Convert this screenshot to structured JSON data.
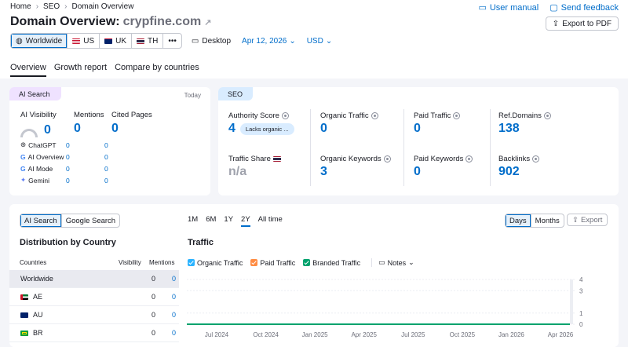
{
  "breadcrumb": [
    "Home",
    "SEO",
    "Domain Overview"
  ],
  "header": {
    "title_prefix": "Domain Overview:",
    "domain": "crypfine.com",
    "user_manual": "User manual",
    "send_feedback": "Send feedback",
    "export_pdf": "Export to PDF"
  },
  "filters": {
    "regions": [
      "Worldwide",
      "US",
      "UK",
      "TH"
    ],
    "more": "•••",
    "device": "Desktop",
    "date": "Apr 12, 2026",
    "currency": "USD"
  },
  "tabs": [
    "Overview",
    "Growth report",
    "Compare by countries"
  ],
  "ai_search": {
    "badge": "AI Search",
    "date_label": "Today",
    "visibility_label": "AI Visibility",
    "visibility_value": "0",
    "mentions_label": "Mentions",
    "mentions_value": "0",
    "cited_label": "Cited Pages",
    "cited_value": "0",
    "rows": [
      {
        "name": "ChatGPT",
        "mentions": "0",
        "cited": "0"
      },
      {
        "name": "AI Overview",
        "mentions": "0",
        "cited": "0"
      },
      {
        "name": "AI Mode",
        "mentions": "0",
        "cited": "0"
      },
      {
        "name": "Gemini",
        "mentions": "0",
        "cited": "0"
      }
    ]
  },
  "seo": {
    "badge": "SEO",
    "authority_label": "Authority Score",
    "authority_value": "4",
    "authority_note": "Lacks organic ...",
    "organic_traffic_label": "Organic Traffic",
    "organic_traffic_value": "0",
    "paid_traffic_label": "Paid Traffic",
    "paid_traffic_value": "0",
    "ref_domains_label": "Ref.Domains",
    "ref_domains_value": "138",
    "traffic_share_label": "Traffic Share",
    "traffic_share_value": "n/a",
    "organic_keywords_label": "Organic Keywords",
    "organic_keywords_value": "3",
    "paid_keywords_label": "Paid Keywords",
    "paid_keywords_value": "0",
    "backlinks_label": "Backlinks",
    "backlinks_value": "902"
  },
  "distribution": {
    "toggle": [
      "AI Search",
      "Google Search"
    ],
    "title": "Distribution by Country",
    "columns": [
      "Countries",
      "Visibility",
      "Mentions"
    ],
    "rows": [
      {
        "country": "Worldwide",
        "visibility": "0",
        "mentions": "0"
      },
      {
        "country": "AE",
        "visibility": "0",
        "mentions": "0"
      },
      {
        "country": "AU",
        "visibility": "0",
        "mentions": "0"
      },
      {
        "country": "BR",
        "visibility": "0",
        "mentions": "0"
      }
    ]
  },
  "traffic": {
    "periods": [
      "1M",
      "6M",
      "1Y",
      "2Y",
      "All time"
    ],
    "active_period": "2Y",
    "granularity": [
      "Days",
      "Months"
    ],
    "export": "Export",
    "title": "Traffic",
    "legend": [
      {
        "name": "Organic Traffic",
        "color": "#2bb3ff"
      },
      {
        "name": "Paid Traffic",
        "color": "#ff8c43"
      },
      {
        "name": "Branded Traffic",
        "color": "#00a26d"
      }
    ],
    "notes": "Notes"
  },
  "chart_data": {
    "type": "line",
    "x_ticks": [
      "Jul 2024",
      "Oct 2024",
      "Jan 2025",
      "Apr 2025",
      "Jul 2025",
      "Oct 2025",
      "Jan 2026",
      "Apr 2026"
    ],
    "y_ticks": [
      4,
      3,
      1,
      0
    ],
    "ylim": [
      0,
      4
    ],
    "series": [
      {
        "name": "Organic Traffic",
        "values": [
          0,
          0,
          0,
          0,
          0,
          0,
          0,
          0
        ]
      },
      {
        "name": "Branded Traffic",
        "values": [
          0,
          0,
          0,
          0,
          0,
          0,
          0,
          0
        ]
      }
    ]
  }
}
